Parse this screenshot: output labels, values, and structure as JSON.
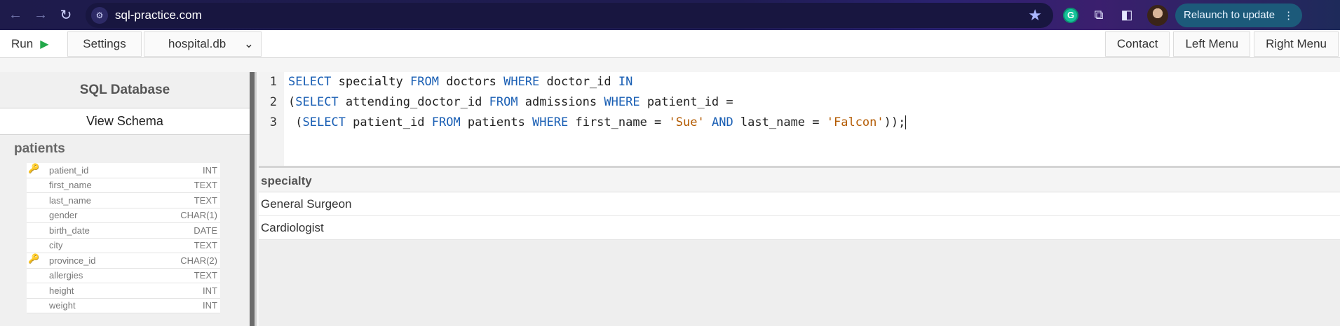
{
  "browser": {
    "url": "sql-practice.com",
    "relaunch_label": "Relaunch to update"
  },
  "toolbar": {
    "run_label": "Run",
    "settings_label": "Settings",
    "database_selected": "hospital.db",
    "contact_label": "Contact",
    "left_menu_label": "Left Menu",
    "right_menu_label": "Right Menu"
  },
  "sidebar": {
    "title": "SQL Database",
    "view_schema_label": "View Schema",
    "table_name": "patients",
    "columns": [
      {
        "name": "patient_id",
        "type": "INT",
        "key": "primary"
      },
      {
        "name": "first_name",
        "type": "TEXT",
        "key": ""
      },
      {
        "name": "last_name",
        "type": "TEXT",
        "key": ""
      },
      {
        "name": "gender",
        "type": "CHAR(1)",
        "key": ""
      },
      {
        "name": "birth_date",
        "type": "DATE",
        "key": ""
      },
      {
        "name": "city",
        "type": "TEXT",
        "key": ""
      },
      {
        "name": "province_id",
        "type": "CHAR(2)",
        "key": "foreign"
      },
      {
        "name": "allergies",
        "type": "TEXT",
        "key": ""
      },
      {
        "name": "height",
        "type": "INT",
        "key": ""
      },
      {
        "name": "weight",
        "type": "INT",
        "key": ""
      }
    ]
  },
  "editor": {
    "line_numbers": [
      "1",
      "2",
      "3"
    ],
    "lines": [
      [
        {
          "t": "SELECT",
          "c": "kw"
        },
        {
          "t": " specialty ",
          "c": ""
        },
        {
          "t": "FROM",
          "c": "kw"
        },
        {
          "t": " doctors ",
          "c": ""
        },
        {
          "t": "WHERE",
          "c": "kw"
        },
        {
          "t": " doctor_id ",
          "c": ""
        },
        {
          "t": "IN",
          "c": "kw"
        }
      ],
      [
        {
          "t": "(",
          "c": ""
        },
        {
          "t": "SELECT",
          "c": "kw"
        },
        {
          "t": " attending_doctor_id ",
          "c": ""
        },
        {
          "t": "FROM",
          "c": "kw"
        },
        {
          "t": " admissions ",
          "c": ""
        },
        {
          "t": "WHERE",
          "c": "kw"
        },
        {
          "t": " patient_id =",
          "c": ""
        }
      ],
      [
        {
          "t": " (",
          "c": ""
        },
        {
          "t": "SELECT",
          "c": "kw"
        },
        {
          "t": " patient_id ",
          "c": ""
        },
        {
          "t": "FROM",
          "c": "kw"
        },
        {
          "t": " patients ",
          "c": ""
        },
        {
          "t": "WHERE",
          "c": "kw"
        },
        {
          "t": " first_name = ",
          "c": ""
        },
        {
          "t": "'Sue'",
          "c": "str"
        },
        {
          "t": " ",
          "c": ""
        },
        {
          "t": "AND",
          "c": "kw"
        },
        {
          "t": " last_name = ",
          "c": ""
        },
        {
          "t": "'Falcon'",
          "c": "str"
        },
        {
          "t": "));",
          "c": ""
        }
      ]
    ]
  },
  "results": {
    "column": "specialty",
    "rows": [
      "General Surgeon",
      "Cardiologist"
    ]
  }
}
